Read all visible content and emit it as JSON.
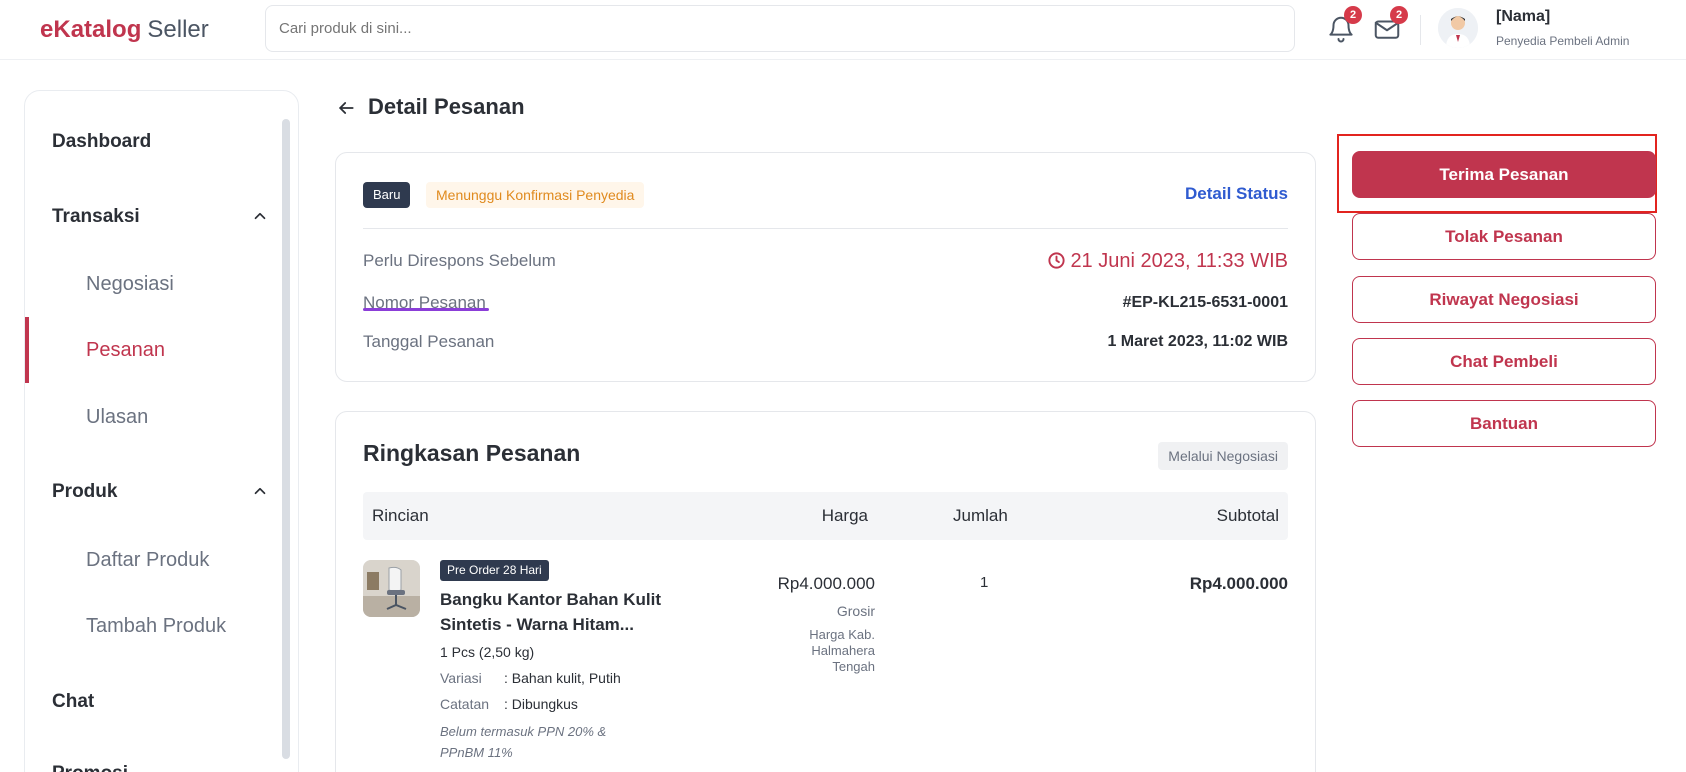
{
  "header": {
    "logo_mark": "e",
    "logo_brand": "Katalog",
    "logo_suffix": "Seller",
    "search_placeholder": "Cari produk di sini...",
    "notifications_count": "2",
    "messages_count": "2",
    "user_name": "[Nama]",
    "user_role": "Penyedia  Pembeli  Admin"
  },
  "sidebar": {
    "items": [
      {
        "label": "Dashboard"
      },
      {
        "label": "Transaksi"
      },
      {
        "label": "Negosiasi"
      },
      {
        "label": "Pesanan"
      },
      {
        "label": "Ulasan"
      },
      {
        "label": "Produk"
      },
      {
        "label": "Daftar Produk"
      },
      {
        "label": "Tambah Produk"
      },
      {
        "label": "Chat"
      },
      {
        "label": "Promosi"
      }
    ]
  },
  "page": {
    "title": "Detail Pesanan"
  },
  "status_card": {
    "badge_new": "Baru",
    "badge_status": "Menunggu Konfirmasi Penyedia",
    "detail_status_link": "Detail Status",
    "rows": [
      {
        "label": "Perlu Direspons Sebelum",
        "value": "21 Juni 2023, 11:33 WIB"
      },
      {
        "label": "Nomor Pesanan",
        "value": "#EP-KL215-6531-0001"
      },
      {
        "label": "Tanggal Pesanan",
        "value": "1 Maret 2023, 11:02 WIB"
      }
    ]
  },
  "summary": {
    "title": "Ringkasan Pesanan",
    "channel_badge": "Melalui Negosiasi",
    "columns": [
      "Rincian",
      "Harga",
      "Jumlah",
      "Subtotal"
    ],
    "item": {
      "preorder_badge": "Pre Order 28 Hari",
      "name": "Bangku Kantor Bahan Kulit Sintetis - Warna Hitam...",
      "weight": "1 Pcs (2,50 kg)",
      "variant_label": "Variasi",
      "variant_value": ": Bahan kulit, Putih",
      "note_label": "Catatan",
      "note_value": ": Dibungkus",
      "tax_note": "Belum termasuk PPN 20% & PPnBM 11%",
      "price": "Rp4.000.000",
      "price_type": "Grosir",
      "price_region": "Harga Kab. Halmahera Tengah",
      "qty": "1",
      "subtotal": "Rp4.000.000"
    }
  },
  "actions": {
    "accept": "Terima Pesanan",
    "reject": "Tolak Pesanan",
    "history": "Riwayat Negosiasi",
    "chat": "Chat Pembeli",
    "help": "Bantuan"
  },
  "colors": {
    "brand": "#c0354e",
    "link_blue": "#2f5bd0",
    "warning": "#e08a1e",
    "highlight": "#e2241f"
  },
  "icons": {
    "notifications": "bell-icon",
    "messages": "mail-icon",
    "deadline": "clock-icon",
    "back": "arrow-left-icon",
    "expand": "chevron-up-icon"
  }
}
